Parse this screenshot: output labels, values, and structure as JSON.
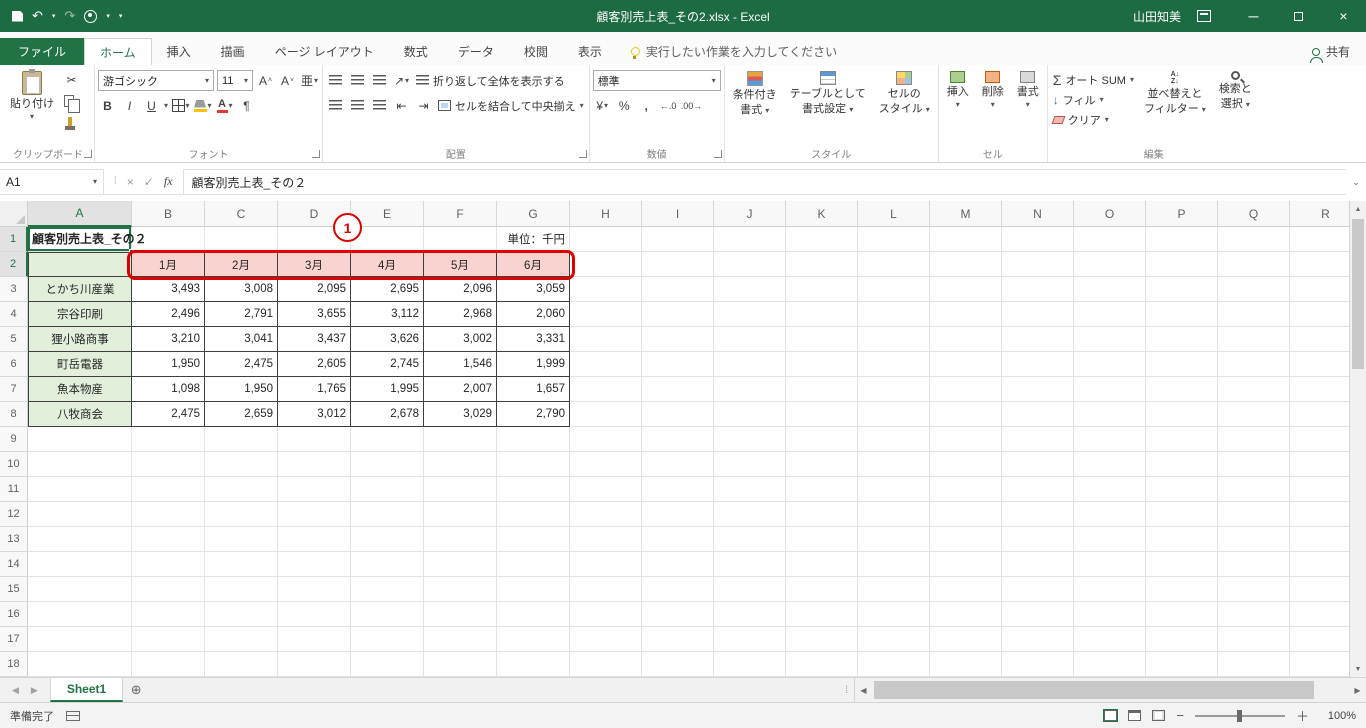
{
  "titlebar": {
    "title": "顧客別売上表_その2.xlsx  -  Excel",
    "user": "山田知美"
  },
  "ribbon_tabs": {
    "file": "ファイル",
    "items": [
      "ホーム",
      "挿入",
      "描画",
      "ページ レイアウト",
      "数式",
      "データ",
      "校閲",
      "表示"
    ],
    "active": "ホーム",
    "tellme": "実行したい作業を入力してください",
    "share": "共有"
  },
  "ribbon": {
    "paste": "貼り付け",
    "clipboard_group": "クリップボード",
    "font_name": "游ゴシック",
    "font_size": "11",
    "font_group": "フォント",
    "wrap_text": "折り返して全体を表示する",
    "merge_center": "セルを結合して中央揃え",
    "align_group": "配置",
    "number_format": "標準",
    "number_group": "数値",
    "cond_format_1": "条件付き",
    "cond_format_2": "書式",
    "format_table_1": "テーブルとして",
    "format_table_2": "書式設定",
    "cell_styles_1": "セルの",
    "cell_styles_2": "スタイル",
    "styles_group": "スタイル",
    "insert": "挿入",
    "delete": "削除",
    "format": "書式",
    "cells_group": "セル",
    "autosum": "オート SUM",
    "fill": "フィル",
    "clear": "クリア",
    "sort_1": "並べ替えと",
    "sort_2": "フィルター",
    "find_1": "検索と",
    "find_2": "選択",
    "editing_group": "編集"
  },
  "formula": {
    "name_box": "A1",
    "fx": "fx",
    "content": "顧客別売上表_その２"
  },
  "sheet": {
    "col_letters": [
      "A",
      "B",
      "C",
      "D",
      "E",
      "F",
      "G",
      "H",
      "I",
      "J",
      "K",
      "L",
      "M",
      "N",
      "O",
      "P",
      "Q",
      "R"
    ],
    "row_count": 18,
    "title": "顧客別売上表_その２",
    "unit": "単位：千円",
    "months": [
      "1月",
      "2月",
      "3月",
      "4月",
      "5月",
      "6月"
    ],
    "rows": [
      {
        "name": "とかち川産業",
        "values": [
          "3,493",
          "3,008",
          "2,095",
          "2,695",
          "2,096",
          "3,059"
        ]
      },
      {
        "name": "宗谷印刷",
        "values": [
          "2,496",
          "2,791",
          "3,655",
          "3,112",
          "2,968",
          "2,060"
        ]
      },
      {
        "name": "狸小路商事",
        "values": [
          "3,210",
          "3,041",
          "3,437",
          "3,626",
          "3,002",
          "3,331"
        ]
      },
      {
        "name": "町岳電器",
        "values": [
          "1,950",
          "2,475",
          "2,605",
          "2,745",
          "1,546",
          "1,999"
        ]
      },
      {
        "name": "魚本物産",
        "values": [
          "1,098",
          "1,950",
          "1,765",
          "1,995",
          "2,007",
          "1,657"
        ]
      },
      {
        "name": "八牧商会",
        "values": [
          "2,475",
          "2,659",
          "3,012",
          "2,678",
          "3,029",
          "2,790"
        ]
      }
    ],
    "callout_number": "1"
  },
  "tabsbar": {
    "sheet": "Sheet1"
  },
  "statusbar": {
    "mode": "準備完了",
    "zoom": "100%"
  },
  "colors": {
    "accent": "#217346",
    "titlebar": "#1d6b43",
    "callout": "#e10000",
    "month_fill": "#f8d3d0",
    "name_fill": "#e2efda"
  }
}
